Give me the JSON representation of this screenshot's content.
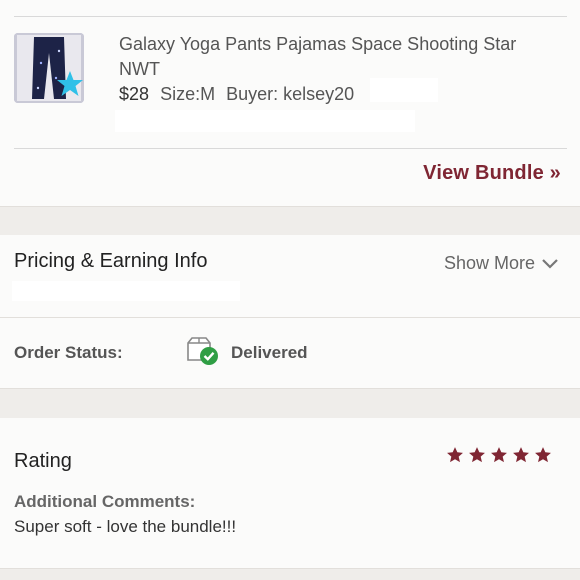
{
  "item": {
    "title": "Galaxy Yoga Pants Pajamas Space Shooting Star NWT",
    "price": "$28",
    "size": "Size:M",
    "buyer": "Buyer: kelsey20",
    "thumbnail_badge_icon": "star-badge-icon"
  },
  "bundle": {
    "view_label": "View Bundle »"
  },
  "pricing": {
    "title": "Pricing & Earning Info",
    "show_more": "Show More",
    "show_more_icon": "chevron-down-icon"
  },
  "order": {
    "label": "Order Status:",
    "value": "Delivered",
    "icon": "delivered-box-check-icon"
  },
  "rating": {
    "title": "Rating",
    "stars": 5,
    "max_stars": 5,
    "star_color": "#7f2633",
    "comments_label": "Additional Comments:",
    "comments": "Super soft - love the bundle!!!"
  },
  "colors": {
    "accent": "#7f2633",
    "check": "#2f9e44"
  }
}
